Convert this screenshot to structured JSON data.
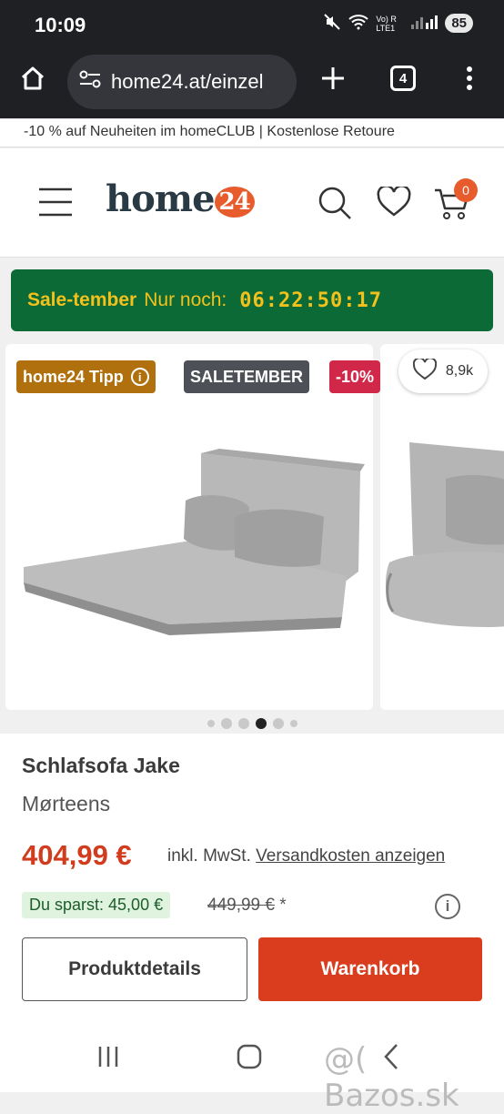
{
  "status": {
    "time": "10:09",
    "network": "Vo) R LTE1",
    "battery": "85"
  },
  "browser": {
    "url": "home24.at/einzel",
    "tab_count": "4"
  },
  "promo": {
    "text": "-10 % auf Neuheiten im homeCLUB | Kostenlose Retoure"
  },
  "header": {
    "logo_text": "home",
    "logo_num": "24",
    "cart_count": "0"
  },
  "sale_banner": {
    "label": "Sale-tember",
    "prefix": "Nur noch:",
    "countdown": "06:22:50:17"
  },
  "badges": {
    "tipp": "home24 Tipp",
    "saletember": "SALETEMBER",
    "discount": "-10%"
  },
  "likes": {
    "count": "8,9k"
  },
  "gallery": {
    "total": 6,
    "active_index": 4
  },
  "product": {
    "title": "Schlafsofa Jake",
    "brand": "Mørteens",
    "price": "404,99 €",
    "vat_text": "inkl. MwSt.",
    "shipping_link": "Versandkosten anzeigen",
    "savings": "Du sparst: 45,00 €",
    "old_price": "449,99 €",
    "old_price_note": "*"
  },
  "buttons": {
    "details": "Produktdetails",
    "cart": "Warenkorb"
  },
  "watermark": "@( Bazos.sk",
  "colors": {
    "accent": "#d93d1e",
    "sale_bg": "#0c6a37",
    "sale_text": "#f3c11b",
    "tipp_bg": "#b0700e",
    "saletember_bg": "#4d5157",
    "discount_bg": "#d1284a"
  }
}
